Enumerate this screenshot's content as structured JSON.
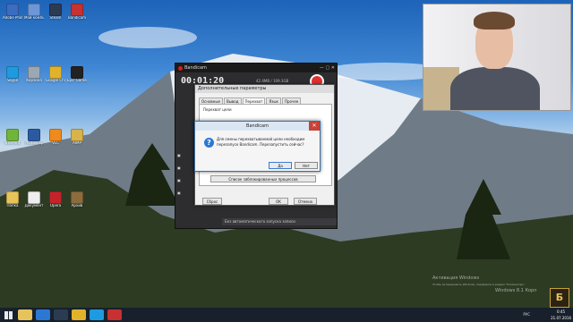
{
  "desktop_icons": [
    {
      "label": "Adobe Photoshop",
      "icon": "app-icon",
      "color": "#3a6cc2"
    },
    {
      "label": "Мой компьютер",
      "icon": "computer-icon",
      "color": "#6d97d6"
    },
    {
      "label": "Steam",
      "icon": "steam-icon",
      "color": "#2b3b52"
    },
    {
      "label": "Bandicam",
      "icon": "record-icon",
      "color": "#c73131"
    },
    {
      "label": "Skype",
      "icon": "skype-icon",
      "color": "#1e9be0"
    },
    {
      "label": "Корзина",
      "icon": "trash-icon",
      "color": "#9aa7b4"
    },
    {
      "label": "Google Chrome",
      "icon": "chrome-icon",
      "color": "#e2b22b"
    },
    {
      "label": "Epic Games",
      "icon": "epic-icon",
      "color": "#222222"
    },
    {
      "label": "uTorrent",
      "icon": "torrent-icon",
      "color": "#6fb53a"
    },
    {
      "label": "Photoshop",
      "icon": "ps-icon",
      "color": "#2c5aa0"
    },
    {
      "label": "VLC",
      "icon": "vlc-icon",
      "color": "#f08a1c"
    },
    {
      "label": "AIMP",
      "icon": "music-icon",
      "color": "#d8b24a"
    },
    {
      "label": "Папка",
      "icon": "folder-icon",
      "color": "#e7c35b"
    },
    {
      "label": "Документ",
      "icon": "document-icon",
      "color": "#eeeeee"
    },
    {
      "label": "Opera",
      "icon": "opera-icon",
      "color": "#c4232a"
    },
    {
      "label": "Архив",
      "icon": "archive-icon",
      "color": "#8c6b3d"
    }
  ],
  "bandicam": {
    "title": "Bandicam",
    "timer": "00:01:20",
    "size": "42.4MB / 109.3GB",
    "pause": "II",
    "status": "Без автоматического запуска записи"
  },
  "settings": {
    "title": "Дополнительные параметры",
    "tabs": [
      "Основные",
      "Вывод",
      "Перехват",
      "Язык",
      "Прочее"
    ],
    "active_tab": "Перехват",
    "group_label": "Перехват цели",
    "list_button": "Список заблокированных процессов",
    "reset": "Сброс",
    "ok": "OK",
    "cancel": "Отмена"
  },
  "dialog": {
    "title": "Bandicam",
    "message": "Для смены перехватываемой цели необходим перезапуск Bandicam. Перезапустить сейчас?",
    "yes": "Да",
    "no": "Нет"
  },
  "taskbar": {
    "lang": "РУС",
    "time": "0:45",
    "date": "21.07.2016",
    "watermark": "Активация Windows",
    "watermark_sub": "Чтобы активировать Windows, перейдите в раздел \"Компьютер\".",
    "os": "Windows 8.1 Корп"
  },
  "logo_letter": "Б"
}
